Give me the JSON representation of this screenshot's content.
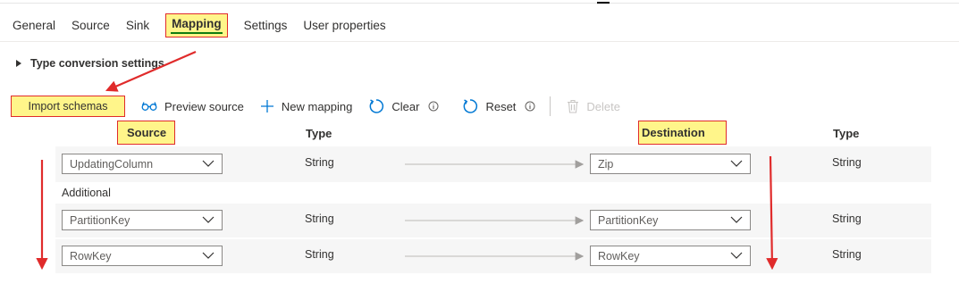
{
  "tabs": [
    "General",
    "Source",
    "Sink",
    "Mapping",
    "Settings",
    "User properties"
  ],
  "active_tab": "Mapping",
  "type_conversion_label": "Type conversion settings",
  "toolbar": {
    "import": "Import schemas",
    "preview": "Preview source",
    "new_mapping": "New mapping",
    "clear": "Clear",
    "reset": "Reset",
    "delete": "Delete"
  },
  "headers": {
    "source": "Source",
    "source_type": "Type",
    "destination": "Destination",
    "dest_type": "Type"
  },
  "additional_label": "Additional",
  "rows": [
    {
      "source": "UpdatingColumn",
      "type": "String",
      "destination": "Zip",
      "dest_type": "String"
    },
    {
      "source": "PartitionKey",
      "type": "String",
      "destination": "PartitionKey",
      "dest_type": "String"
    },
    {
      "source": "RowKey",
      "type": "String",
      "destination": "RowKey",
      "dest_type": "String"
    }
  ],
  "colors": {
    "highlight": "#fff58a",
    "annotation_red": "#e02b2b",
    "active_underline": "#107c10",
    "icon_blue": "#0078d4"
  },
  "icons": [
    "glasses-icon",
    "plus-icon",
    "refresh-icon",
    "info-icon",
    "trash-icon",
    "chevron-down-icon",
    "caret-right-icon"
  ]
}
